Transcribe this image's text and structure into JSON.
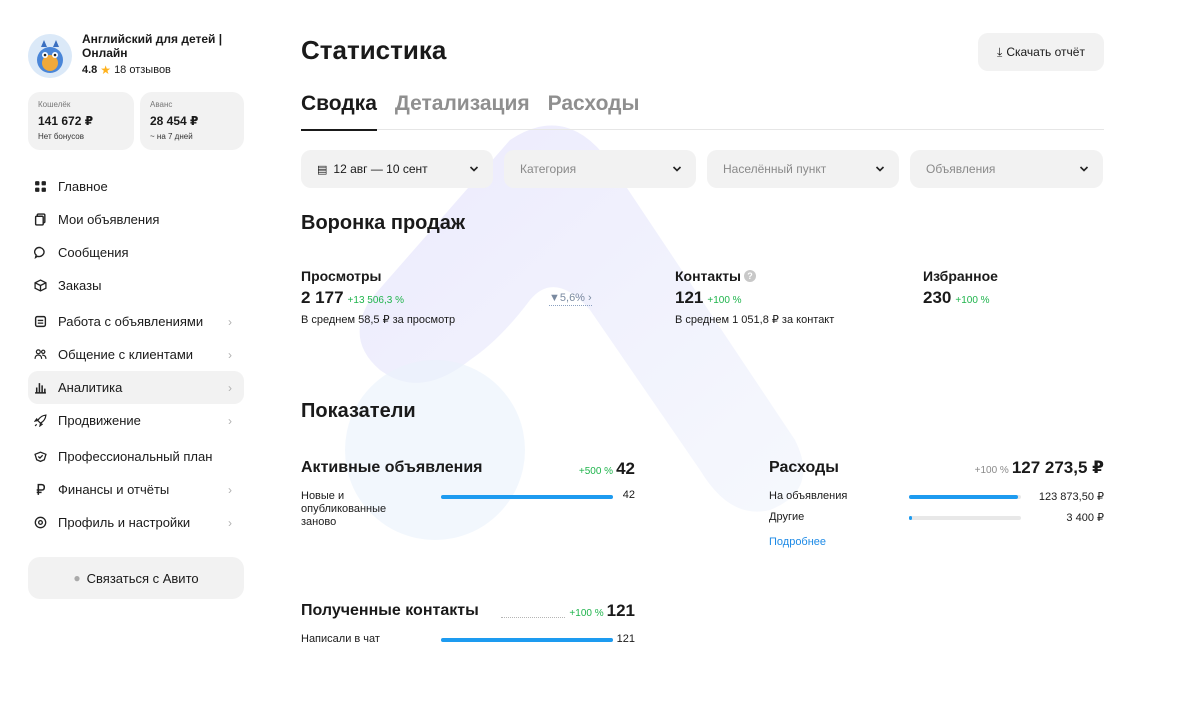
{
  "profile": {
    "name": "Английский для детей | Онлайн",
    "rating": "4.8",
    "reviews": "18 отзывов"
  },
  "wallet": {
    "card1": {
      "label": "Кошелёк",
      "value": "141 672 ₽",
      "sub": "Нет бонусов"
    },
    "card2": {
      "label": "Аванс",
      "value": "28 454 ₽",
      "sub": "~ на 7 дней"
    }
  },
  "nav": [
    {
      "label": "Главное",
      "icon": "grid-icon"
    },
    {
      "label": "Мои объявления",
      "icon": "copy-icon"
    },
    {
      "label": "Сообщения",
      "icon": "chat-icon"
    },
    {
      "label": "Заказы",
      "icon": "box-icon"
    },
    {
      "label": "Работа с объявлениями",
      "icon": "list-icon"
    },
    {
      "label": "Общение с клиентами",
      "icon": "people-icon"
    },
    {
      "label": "Аналитика",
      "icon": "chart-icon"
    },
    {
      "label": "Продвижение",
      "icon": "rocket-icon"
    },
    {
      "label": "Профессиональный план",
      "icon": "badge-icon"
    },
    {
      "label": "Финансы и отчёты",
      "icon": "ruble-icon"
    },
    {
      "label": "Профиль и настройки",
      "icon": "gear-icon"
    }
  ],
  "contact_button": "Связаться с Авито",
  "page": {
    "title": "Статистика",
    "download": "Скачать отчёт",
    "tabs": [
      "Сводка",
      "Детализация",
      "Расходы"
    ]
  },
  "filters": {
    "date": "12 авг — 10 сент",
    "category": "Категория",
    "location": "Населённый пункт",
    "ads": "Объявления"
  },
  "funnel": {
    "title": "Воронка продаж",
    "views": {
      "label": "Просмотры",
      "value": "2 177",
      "delta": "+13 506,3 %",
      "sub": "В среднем 58,5 ₽ за просмотр"
    },
    "conversion": "5,6%",
    "contacts": {
      "label": "Контакты",
      "value": "121",
      "delta": "+100 %",
      "sub": "В среднем 1 051,8 ₽ за контакт"
    },
    "favorites": {
      "label": "Избранное",
      "value": "230",
      "delta": "+100 %"
    }
  },
  "indicators": {
    "title": "Показатели",
    "active_ads": {
      "title": "Активные объявления",
      "delta": "+500 %",
      "total": "42",
      "rows": [
        {
          "label": "Новые и опубликованные заново",
          "value": "42",
          "fill": 1.0
        }
      ]
    },
    "expenses": {
      "title": "Расходы",
      "delta": "+100 %",
      "total": "127 273,5 ₽",
      "rows": [
        {
          "label": "На объявления",
          "value": "123 873,50 ₽",
          "fill": 0.973
        },
        {
          "label": "Другие",
          "value": "3 400 ₽",
          "fill": 0.027
        }
      ],
      "more": "Подробнее"
    },
    "contacts": {
      "title": "Полученные контакты",
      "delta": "+100 %",
      "total": "121",
      "rows": [
        {
          "label": "Написали в чат",
          "value": "121",
          "fill": 1.0
        }
      ]
    }
  }
}
